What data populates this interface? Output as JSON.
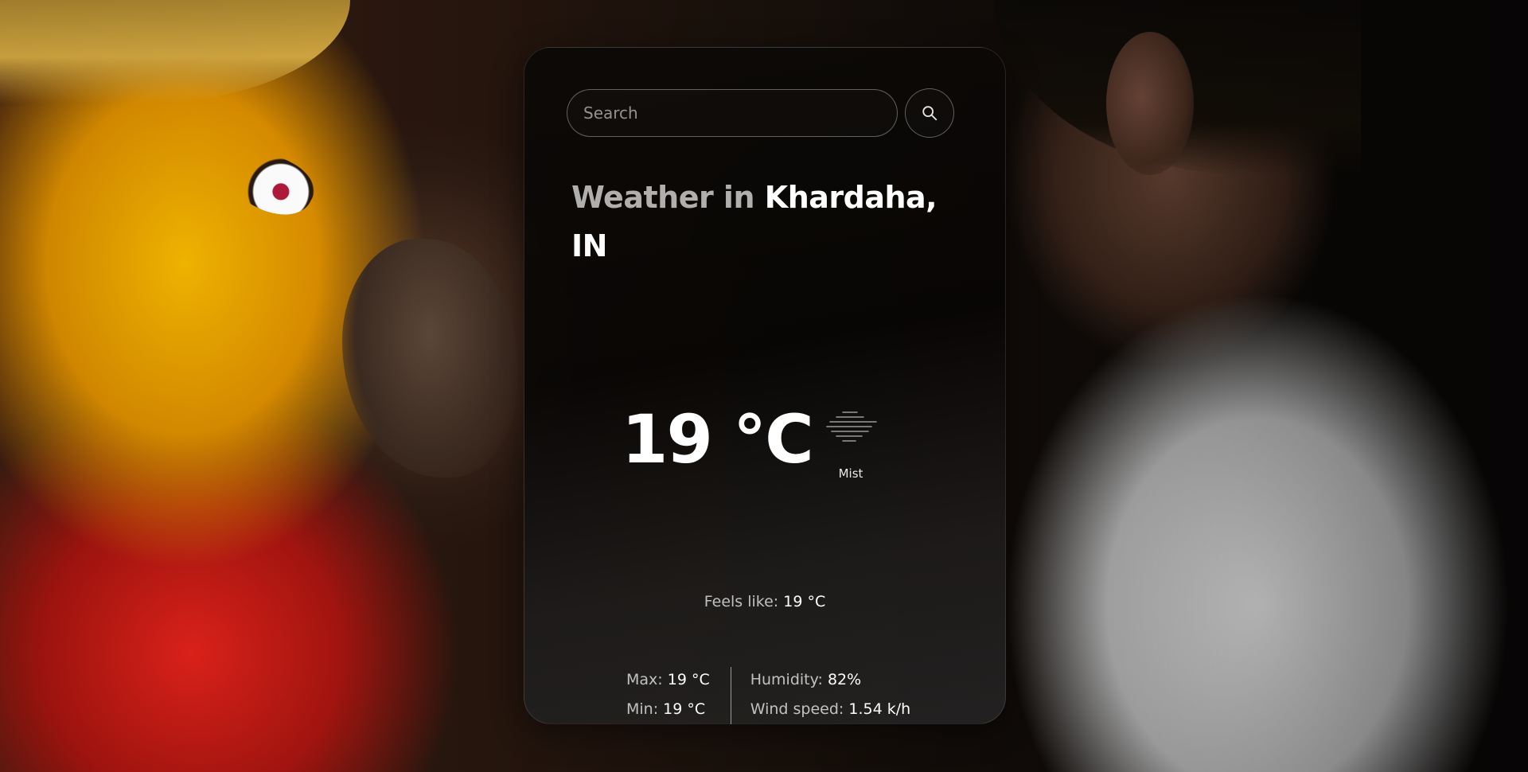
{
  "search": {
    "placeholder": "Search"
  },
  "weather": {
    "title_prefix": "Weather in",
    "location": "Khardaha, IN",
    "temperature": "19 °C",
    "condition": "Mist",
    "condition_icon": "mist-icon",
    "feels_like_label": "Feels like:",
    "feels_like_value": "19 °C",
    "max_label": "Max:",
    "max_value": "19 °C",
    "min_label": "Min:",
    "min_value": "19 °C",
    "humidity_label": "Humidity:",
    "humidity_value": "82%",
    "wind_label": "Wind speed:",
    "wind_value": "1.54 k/h"
  }
}
